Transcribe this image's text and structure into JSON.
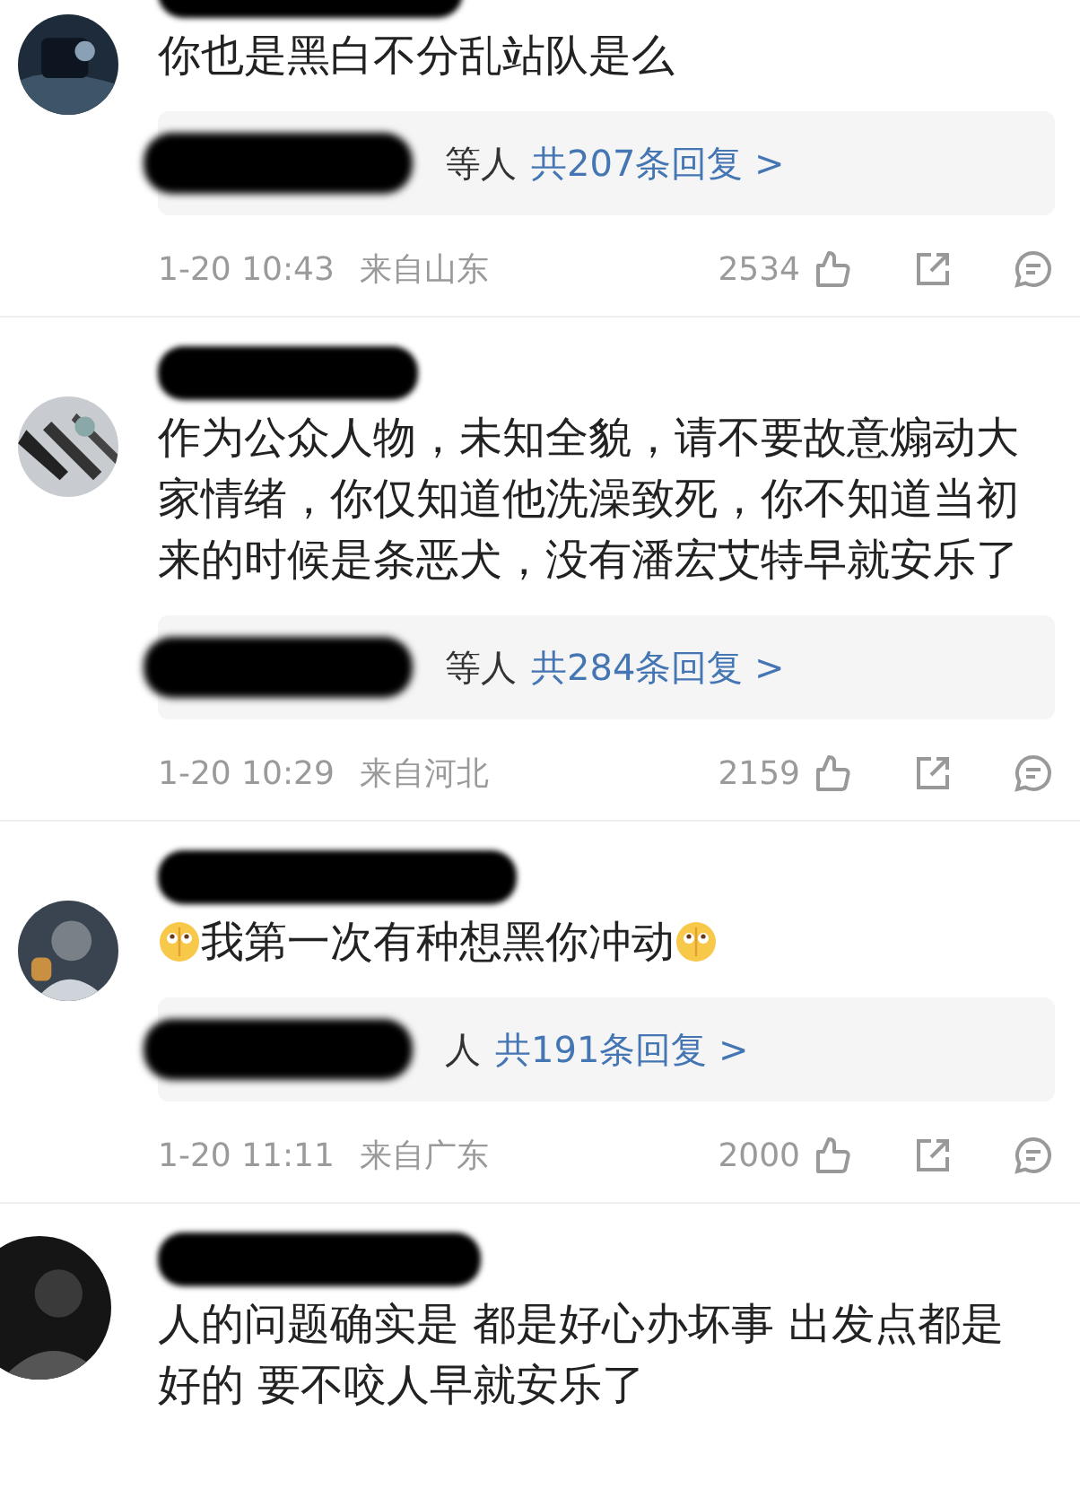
{
  "comments": [
    {
      "text": [
        {
          "kind": "text",
          "text": "你也是黑白不分乱站队是么"
        }
      ],
      "reply": {
        "names": "等人",
        "count": "共207条回复 >"
      },
      "time": "1-20 10:43",
      "location": "来自山东",
      "likes": "2534"
    },
    {
      "text": [
        {
          "kind": "text",
          "text": "作为公众人物，未知全貌，请不要故意煽动大家情绪，你仅知道他洗澡致死，你不知道当初来的时候是条恶犬，没有潘宏艾特早就安乐了"
        }
      ],
      "reply": {
        "names": "等人",
        "count": "共284条回复 >"
      },
      "time": "1-20 10:29",
      "location": "来自河北",
      "likes": "2159"
    },
    {
      "text": [
        {
          "kind": "emoji"
        },
        {
          "kind": "text",
          "text": "我第一次有种想黑你冲动"
        },
        {
          "kind": "emoji"
        }
      ],
      "reply": {
        "names": "人",
        "count": "共191条回复 >"
      },
      "time": "1-20 11:11",
      "location": "来自广东",
      "likes": "2000"
    },
    {
      "text": [
        {
          "kind": "text",
          "text": "人的问题确实是 都是好心办坏事 出发点都是好的 要不咬人早就安乐了"
        }
      ]
    }
  ]
}
